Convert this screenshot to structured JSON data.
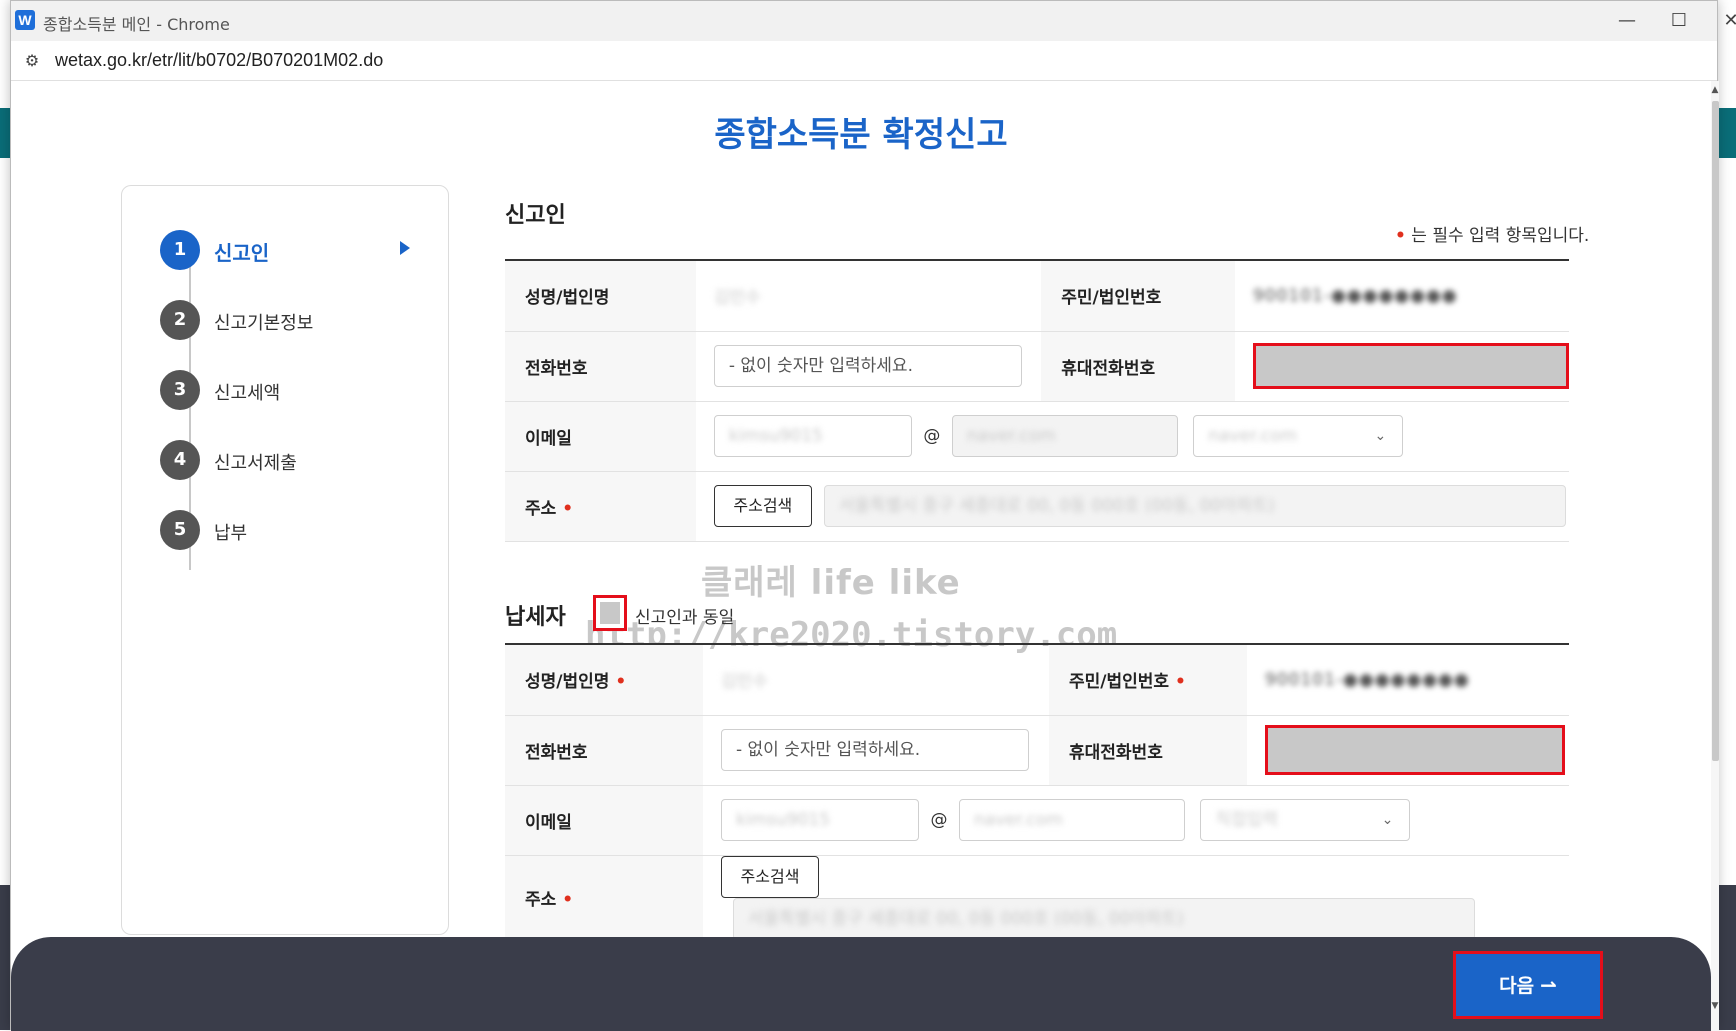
{
  "window": {
    "app_icon": "W",
    "title": "종합소득분 메인 - Chrome",
    "url": "wetax.go.kr/etr/lit/b0702/B070201M02.do",
    "minimize_icon": "minimize-icon",
    "maximize_icon": "maximize-icon",
    "close_icon": "close-icon"
  },
  "page": {
    "title": "종합소득분 확정신고"
  },
  "steps": [
    {
      "num": "1",
      "label": "신고인",
      "active": true
    },
    {
      "num": "2",
      "label": "신고기본정보",
      "active": false
    },
    {
      "num": "3",
      "label": "신고세액",
      "active": false
    },
    {
      "num": "4",
      "label": "신고서제출",
      "active": false
    },
    {
      "num": "5",
      "label": "납부",
      "active": false
    }
  ],
  "reporter": {
    "section_title": "신고인",
    "required_note": "는 필수 입력 항목입니다.",
    "name_label": "성명/법인명",
    "name_value": "김민수",
    "id_label": "주민/법인번호",
    "id_value": "900101-●●●●●●●●",
    "phone_label": "전화번호",
    "phone_placeholder": "- 없이 숫자만 입력하세요.",
    "mobile_label": "휴대전화번호",
    "email_label": "이메일",
    "email_id": "kimsu9015",
    "email_domain": "naver.com",
    "email_select": "naver.com",
    "address_label": "주소",
    "search_button": "주소검색",
    "address_value": "서울특별시 중구 세종대로 00, 0동 000호 (00동, 00아파트)"
  },
  "taxpayer": {
    "section_title": "납세자",
    "same_as_label": "신고인과 동일",
    "name_label": "성명/법인명",
    "name_value": "김민수",
    "id_label": "주민/법인번호",
    "id_value": "900101-●●●●●●●●",
    "phone_label": "전화번호",
    "phone_placeholder": "- 없이 숫자만 입력하세요.",
    "mobile_label": "휴대전화번호",
    "email_label": "이메일",
    "email_id": "kimsu9015",
    "email_domain": "naver.com",
    "email_select": "직접입력",
    "address_label": "주소",
    "search_button": "주소검색",
    "address_value": "서울특별시 중구 세종대로 00, 0동 000호 (00동, 00아파트)"
  },
  "watermark": {
    "line1": "클래레 life like",
    "line2": "http://kre2020.tistory.com"
  },
  "footer": {
    "next_label": "다음",
    "next_icon": "arrow-right-icon"
  },
  "colors": {
    "accent": "#1a64c8",
    "required": "#e0301e",
    "highlight": "#e40e1a",
    "bottom_bar": "#3a3d4a"
  }
}
